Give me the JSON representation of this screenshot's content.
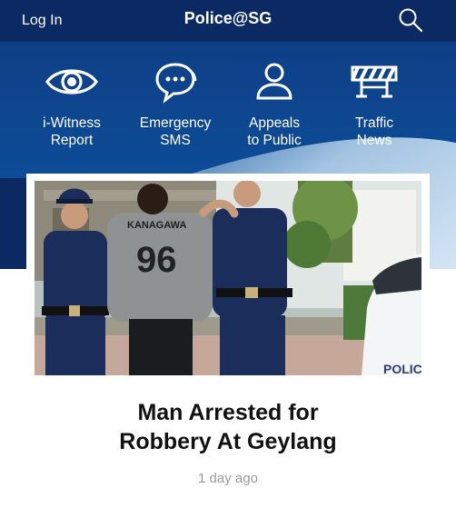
{
  "header": {
    "login_label": "Log In",
    "title": "Police@SG",
    "search_icon": "search-icon"
  },
  "quick_actions": [
    {
      "line1": "i-Witness",
      "line2": "Report",
      "icon": "eye-icon"
    },
    {
      "line1": "Emergency",
      "line2": "SMS",
      "icon": "chat-bubble-icon"
    },
    {
      "line1": "Appeals",
      "line2": "to Public",
      "icon": "person-icon"
    },
    {
      "line1": "Traffic",
      "line2": "News",
      "icon": "road-barrier-icon"
    }
  ],
  "news": {
    "image_alt": "Police officers escorting a man in a grey jersey",
    "jersey_text": "KANAGAWA",
    "jersey_number": "96",
    "headline_line1": "Man Arrested for",
    "headline_line2": "Robbery At Geylang",
    "timestamp": "1 day ago"
  },
  "colors": {
    "header_bg": "#0b2a63",
    "hero_bg": "#0e3f86",
    "uniform": "#1b2d5a"
  }
}
